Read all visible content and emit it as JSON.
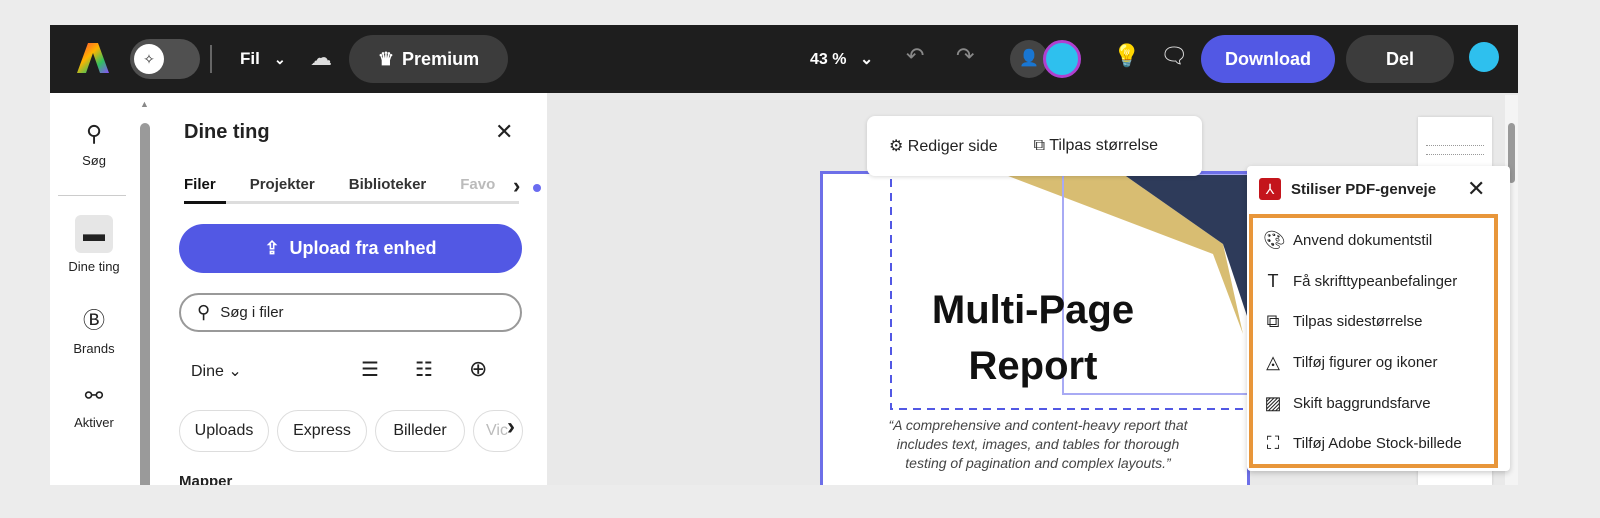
{
  "topbar": {
    "file_label": "Fil",
    "premium_label": "Premium",
    "zoom": "43 %",
    "download_label": "Download",
    "share_label": "Del"
  },
  "rail": {
    "items": [
      {
        "label": "Søg"
      },
      {
        "label": "Dine ting"
      },
      {
        "label": "Brands"
      },
      {
        "label": "Aktiver"
      }
    ]
  },
  "panel": {
    "title": "Dine ting",
    "tabs": [
      "Filer",
      "Projekter",
      "Biblioteker",
      "Favo"
    ],
    "upload_label": "Upload fra enhed",
    "search_placeholder": "Søg i filer",
    "filter_label": "Dine",
    "chips": [
      "Uploads",
      "Express",
      "Billeder",
      "Vic"
    ],
    "section_label": "Mapper"
  },
  "canvas": {
    "edit_page_label": "Rediger side",
    "resize_label": "Tilpas størrelse",
    "doc_title_1": "Multi-Page",
    "doc_title_2": "Report",
    "doc_quote": "“A comprehensive and content-heavy report that includes text, images, and tables for thorough testing of pagination and complex layouts.”"
  },
  "shortcuts": {
    "title": "Stiliser PDF-genveje",
    "items": [
      "Anvend dokumentstil",
      "Få skrifttypeanbefalinger",
      "Tilpas sidestørrelse",
      "Tilføj figurer og ikoner",
      "Skift baggrundsfarve",
      "Tilføj Adobe Stock-billede"
    ]
  },
  "colors": {
    "accent": "#5258e4",
    "highlight": "#e8963a",
    "topbar": "#1e1e1e"
  }
}
